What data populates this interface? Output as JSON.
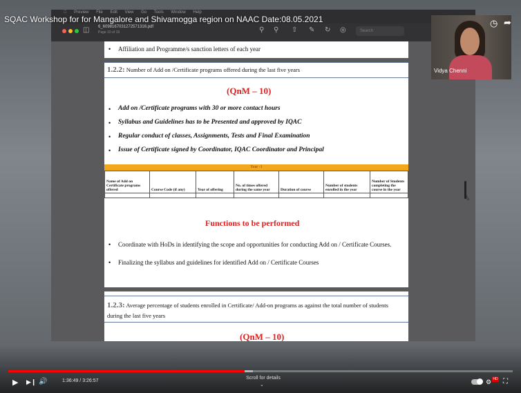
{
  "video": {
    "title": "SQAC Workshop for for Mangalore and Shivamogga region on NAAC Date:08.05.2021",
    "current_time": "1:36:49",
    "duration": "3:26:57",
    "time_display": "1:36:49 / 3:26:57",
    "progress_fraction": 0.469,
    "buffered_fraction": 0.485,
    "scroll_hint": "Scroll for details",
    "accent_color": "#ff0000"
  },
  "participant": {
    "name": "Vidya Chenni"
  },
  "mac": {
    "menu": [
      "Preview",
      "File",
      "Edit",
      "View",
      "Go",
      "Tools",
      "Window",
      "Help"
    ]
  },
  "preview": {
    "file_name": "6_6098167031272571316.pdf",
    "page_indicator": "Page 10 of 19",
    "search_placeholder": "Search"
  },
  "document": {
    "top_bullet": "Affiliation and Programme/s sanction letters of each year",
    "section_122": {
      "number": "1.2.2:",
      "text": "Number of Add on /Certificate programs offered during the last five years",
      "metric": "(QnM – 10)",
      "bullets": [
        "Add on /Certificate programs with  30 or more contact hours",
        "Syllabus and Guidelines has to be Presented and approved by IQAC",
        "Regular conduct of classes, Assignments, Tests and Final Examination",
        "Issue of Certificate signed by Coordinator, IQAC Coordinator and Principal"
      ],
      "table_year": "Year -1",
      "table_headers": [
        "Name of Add on Certificate programs offered",
        "Course Code (if any)",
        "Year of offering",
        "No. of times offered during the same year",
        "Duration of course",
        "Number of students enrolled in the year",
        "Number of Students completing the course in the year"
      ],
      "functions_title": "Functions to be performed",
      "functions": [
        "Coordinate with HoDs in identifying the scope and opportunities for conducting Add on / Certificate Courses.",
        "Finalizing the syllabus and guidelines for identified Add on / Certificate Courses"
      ]
    },
    "section_123": {
      "number": "1.2.3:",
      "text_line1": "Average percentage of students enrolled in Certificate/ Add-on programs as against the total number of students",
      "text_line2": "during the last five years",
      "metric": "(QnM – 10)"
    }
  }
}
